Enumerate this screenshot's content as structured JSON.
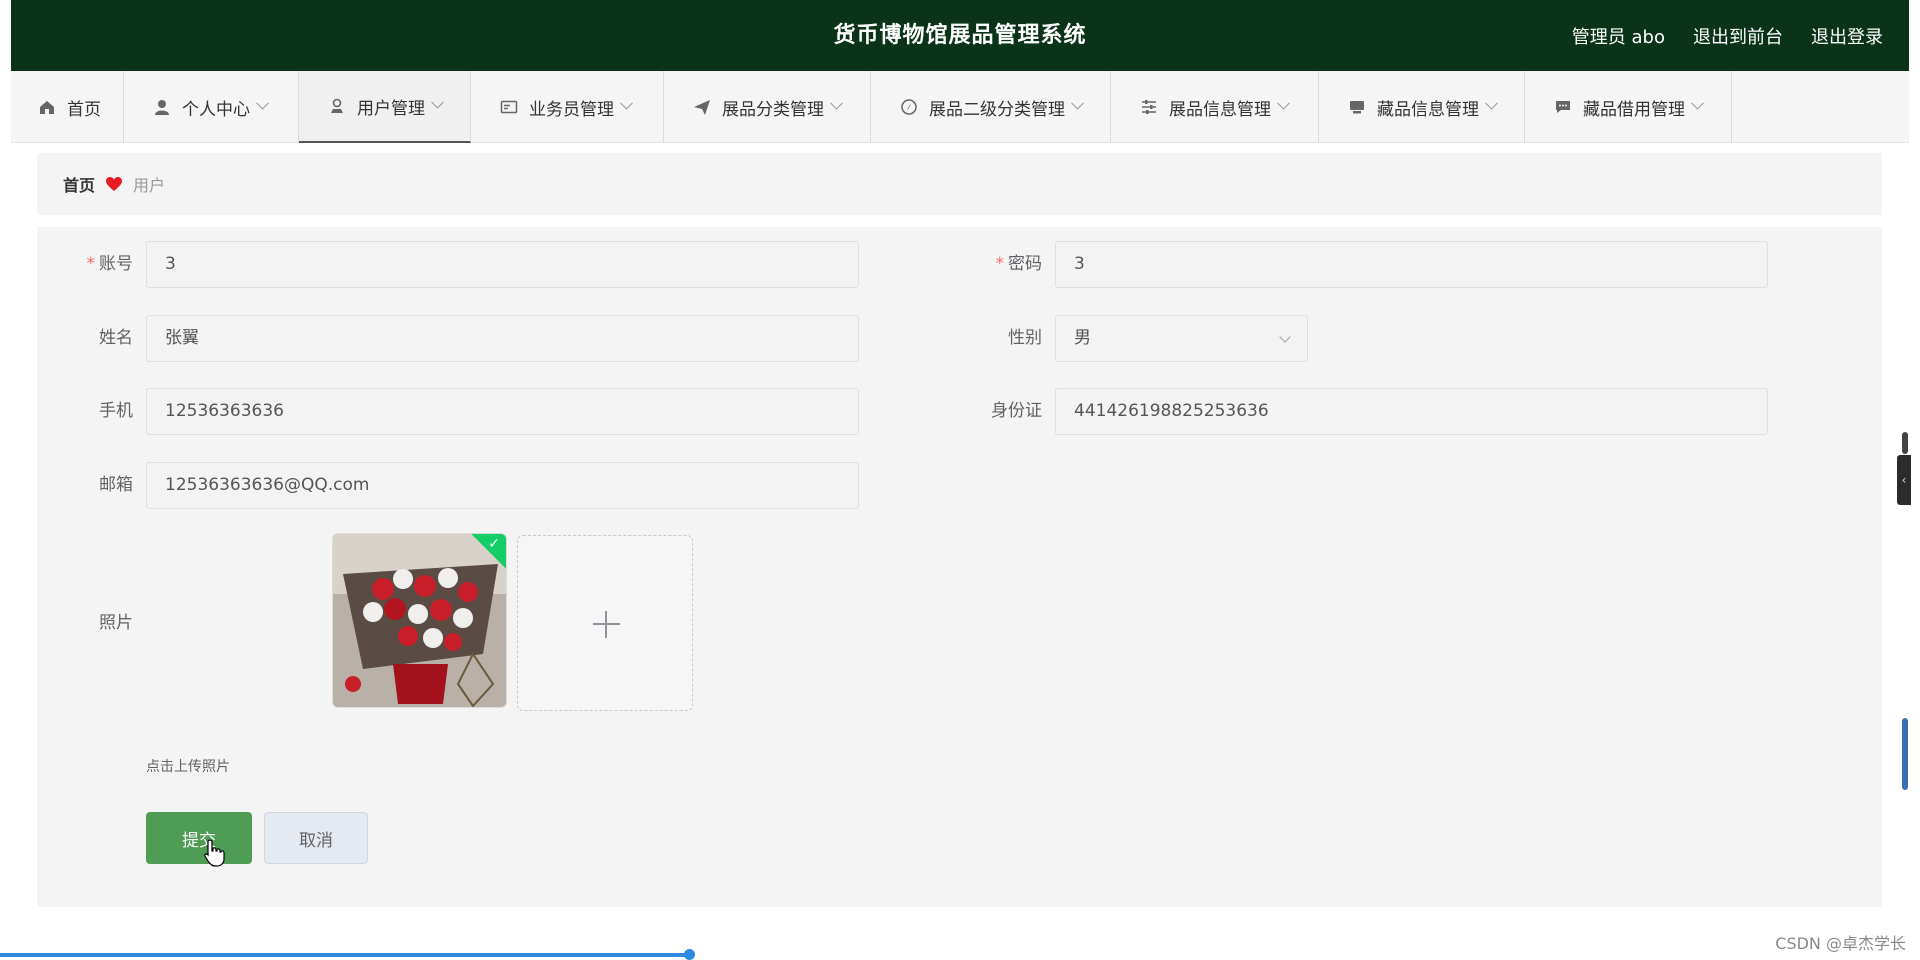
{
  "header": {
    "title": "货币博物馆展品管理系统",
    "user": "管理员 abo",
    "to_front": "退出到前台",
    "logout": "退出登录"
  },
  "nav": [
    {
      "label": "首页",
      "icon": "home-icon"
    },
    {
      "label": "个人中心",
      "icon": "person-icon"
    },
    {
      "label": "用户管理",
      "icon": "user-icon"
    },
    {
      "label": "业务员管理",
      "icon": "card-icon"
    },
    {
      "label": "展品分类管理",
      "icon": "send-icon"
    },
    {
      "label": "展品二级分类管理",
      "icon": "compass-icon"
    },
    {
      "label": "展品信息管理",
      "icon": "sliders-icon"
    },
    {
      "label": "藏品信息管理",
      "icon": "monitor-icon"
    },
    {
      "label": "藏品借用管理",
      "icon": "message-icon"
    }
  ],
  "breadcrumb": {
    "home": "首页",
    "current": "用户"
  },
  "form": {
    "account": {
      "label": "账号",
      "value": "3"
    },
    "password": {
      "label": "密码",
      "value": "3"
    },
    "name": {
      "label": "姓名",
      "value": "张翼"
    },
    "gender": {
      "label": "性别",
      "value": "男"
    },
    "phone": {
      "label": "手机",
      "value": "12536363636"
    },
    "idcard": {
      "label": "身份证",
      "value": "441426198825253636"
    },
    "email": {
      "label": "邮箱",
      "value": "12536363636@QQ.com"
    },
    "photo": {
      "label": "照片",
      "tip": "点击上传照片"
    },
    "submit": "提交",
    "cancel": "取消"
  },
  "watermark": "CSDN @卓杰学长",
  "colors": {
    "header_bg": "#0b3319",
    "primary": "#4f9d55",
    "required": "#f56c6c"
  }
}
